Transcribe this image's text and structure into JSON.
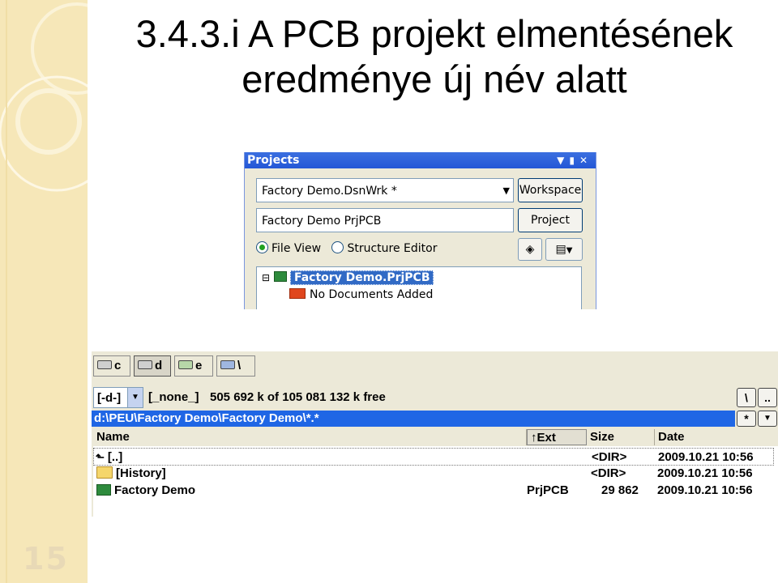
{
  "slide": {
    "title_line1": "3.4.3.i A PCB projekt elmentésének",
    "title_line2": "eredménye új név alatt",
    "number": "15"
  },
  "projects_panel": {
    "header": "Projects",
    "workspace_value": "Factory Demo.DsnWrk *",
    "workspace_button": "Workspace",
    "project_value": "Factory Demo PrjPCB",
    "project_button": "Project",
    "radio_file_view": "File View",
    "radio_structure_editor": "Structure Editor",
    "selected_view": "File View",
    "tree": {
      "project_name": "Factory Demo.PrjPCB",
      "child": "No Documents Added"
    }
  },
  "file_manager": {
    "drives": [
      "c",
      "d",
      "e",
      "\\"
    ],
    "current_drive": "[-d-]",
    "volume_label": "[_none_]",
    "free_space": "505 692 k of 105 081 132 k free",
    "button_root": "\\",
    "button_up": "..",
    "path": "d:\\PEU\\Factory Demo\\Factory Demo\\*.*",
    "button_star": "*",
    "columns": {
      "name": "Name",
      "ext": "↑Ext",
      "size": "Size",
      "date": "Date"
    },
    "rows": [
      {
        "name": "[..]",
        "ext": "",
        "size": "<DIR>",
        "date": "2009.10.21 10:56"
      },
      {
        "name": "[History]",
        "ext": "",
        "size": "<DIR>",
        "date": "2009.10.21 10:56"
      },
      {
        "name": "Factory Demo",
        "ext": "PrjPCB",
        "size": "29 862",
        "date": "2009.10.21 10:56"
      }
    ]
  },
  "colors": {
    "sidebar": "#f6e7b8",
    "title_bar_blue": "#2457d6",
    "selection_blue": "#316ac5",
    "path_bar_blue": "#1f66e5"
  }
}
